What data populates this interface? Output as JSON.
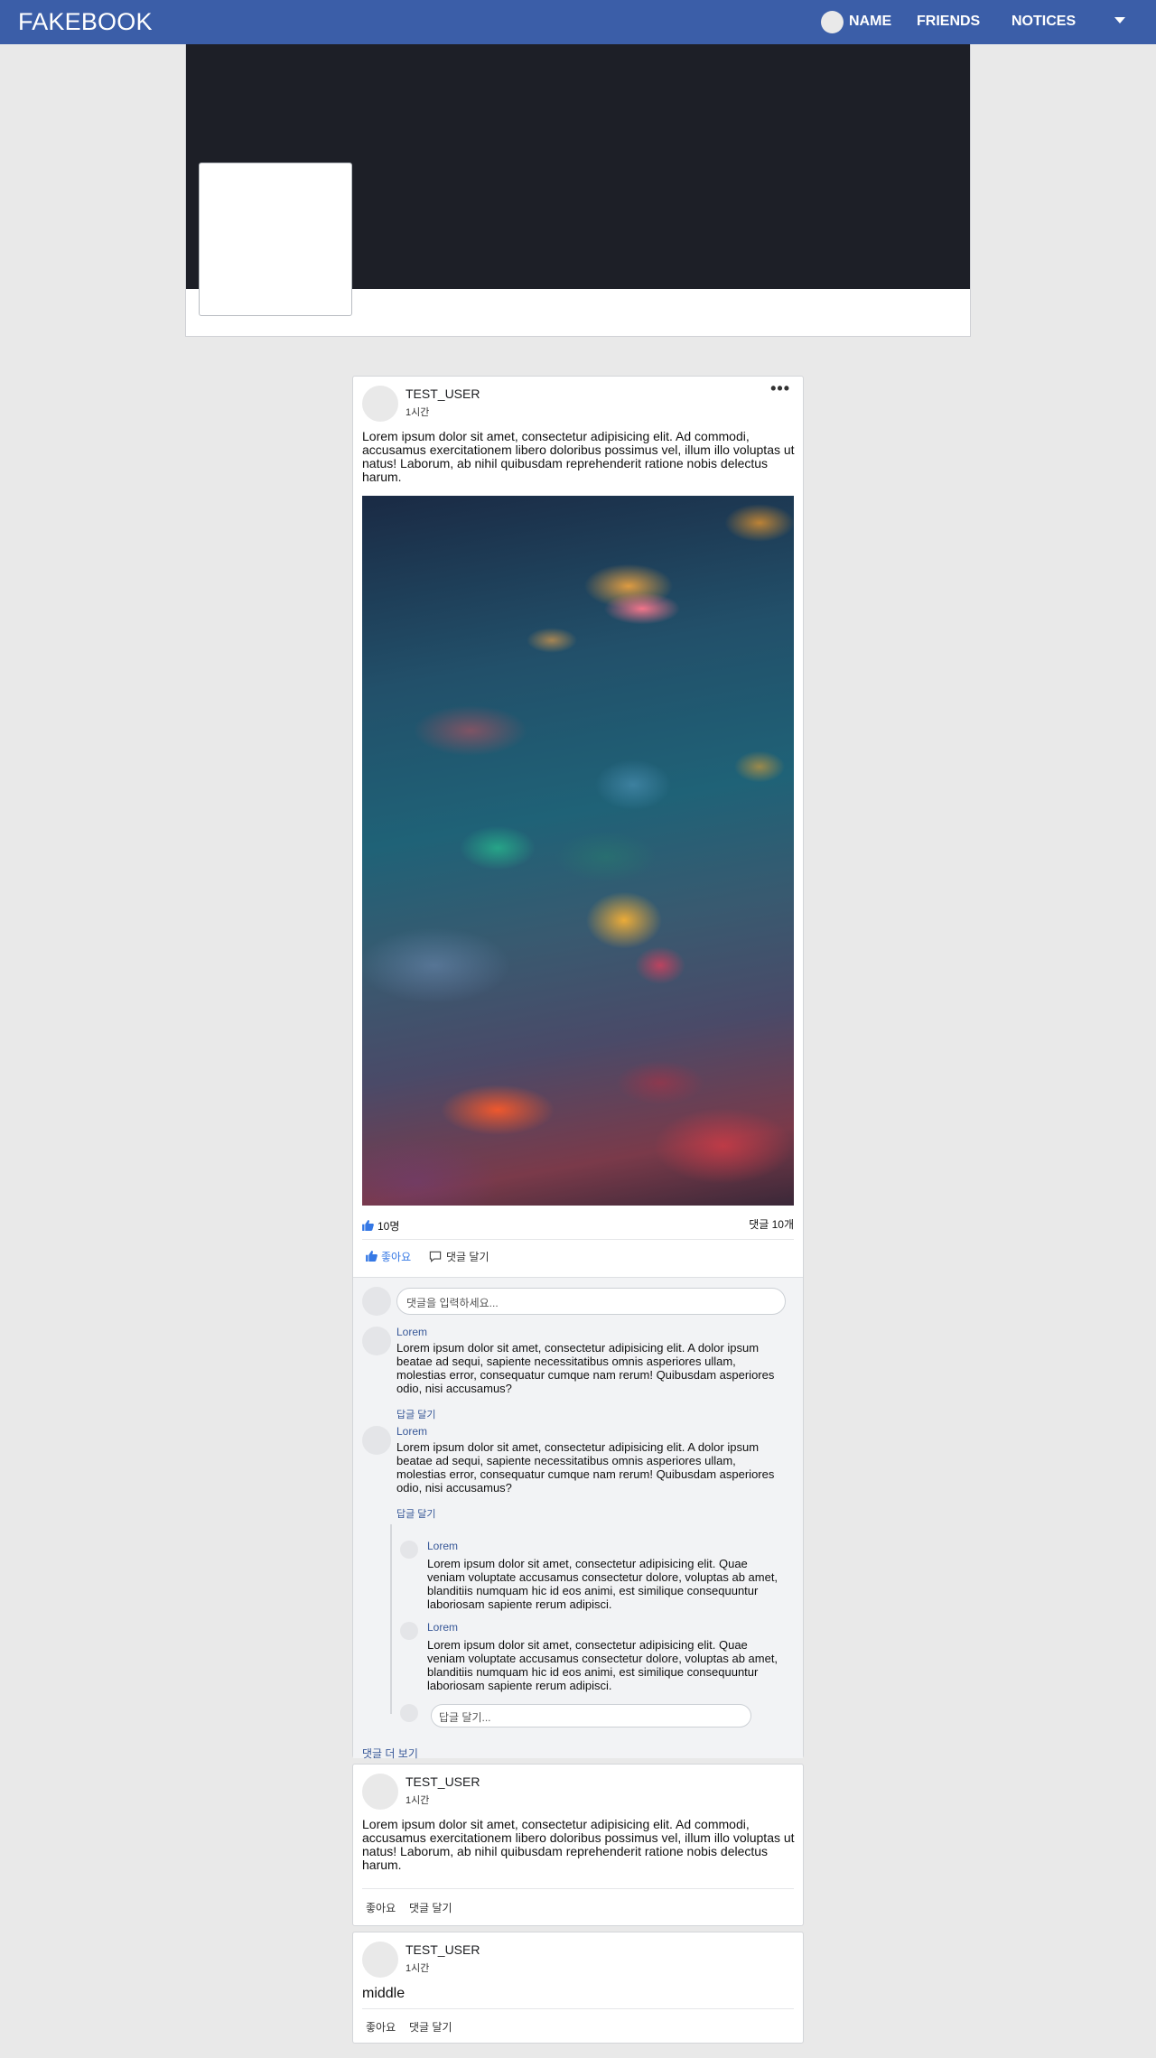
{
  "nav": {
    "brand": "FAKEBOOK",
    "name": "NAME",
    "friends": "FRIENDS",
    "notices": "NOTICES"
  },
  "posts": [
    {
      "author": "TEST_USER",
      "time": "1시간",
      "more": "•••",
      "text": "Lorem ipsum dolor sit amet, consectetur adipisicing elit. Ad commodi, accusamus exercitationem libero doloribus possimus vel, illum illo voluptas ut natus! Laborum, ab nihil quibusdam reprehenderit ratione nobis delectus harum.",
      "likes": "10명",
      "comment_count": "댓글 10개",
      "like_label": "좋아요",
      "comment_label": "댓글 달기",
      "comment_placeholder": "댓글을 입력하세요...",
      "comments": [
        {
          "name": "Lorem",
          "text": "Lorem ipsum dolor sit amet, consectetur adipisicing elit. A dolor ipsum beatae ad sequi, sapiente necessitatibus omnis asperiores ullam, molestias error, consequatur cumque nam rerum! Quibusdam asperiores odio, nisi accusamus?",
          "reply_label": "답글 달기"
        },
        {
          "name": "Lorem",
          "text": "Lorem ipsum dolor sit amet, consectetur adipisicing elit. A dolor ipsum beatae ad sequi, sapiente necessitatibus omnis asperiores ullam, molestias error, consequatur cumque nam rerum! Quibusdam asperiores odio, nisi accusamus?",
          "reply_label": "답글 달기",
          "replies": [
            {
              "name": "Lorem",
              "text": "Lorem ipsum dolor sit amet, consectetur adipisicing elit. Quae veniam voluptate accusamus consectetur dolore, voluptas ab amet, blanditiis numquam hic id eos animi, est similique consequuntur laboriosam sapiente rerum adipisci."
            },
            {
              "name": "Lorem",
              "text": "Lorem ipsum dolor sit amet, consectetur adipisicing elit. Quae veniam voluptate accusamus consectetur dolore, voluptas ab amet, blanditiis numquam hic id eos animi, est similique consequuntur laboriosam sapiente rerum adipisci."
            }
          ],
          "reply_placeholder": "답글 달기..."
        }
      ],
      "more_comments": "댓글 더 보기"
    },
    {
      "author": "TEST_USER",
      "time": "1시간",
      "text": "Lorem ipsum dolor sit amet, consectetur adipisicing elit. Ad commodi, accusamus exercitationem libero doloribus possimus vel, illum illo voluptas ut natus! Laborum, ab nihil quibusdam reprehenderit ratione nobis delectus harum.",
      "like_label": "좋아요",
      "comment_label": "댓글 달기"
    },
    {
      "author": "TEST_USER",
      "time": "1시간",
      "text": "middle",
      "like_label": "좋아요",
      "comment_label": "댓글 달기"
    }
  ],
  "colors": {
    "nav_bg": "#3b5ea8",
    "cover_bg": "#1d1f27",
    "link": "#385898",
    "liked": "#3578e5",
    "page_bg": "#e9e9e9"
  }
}
